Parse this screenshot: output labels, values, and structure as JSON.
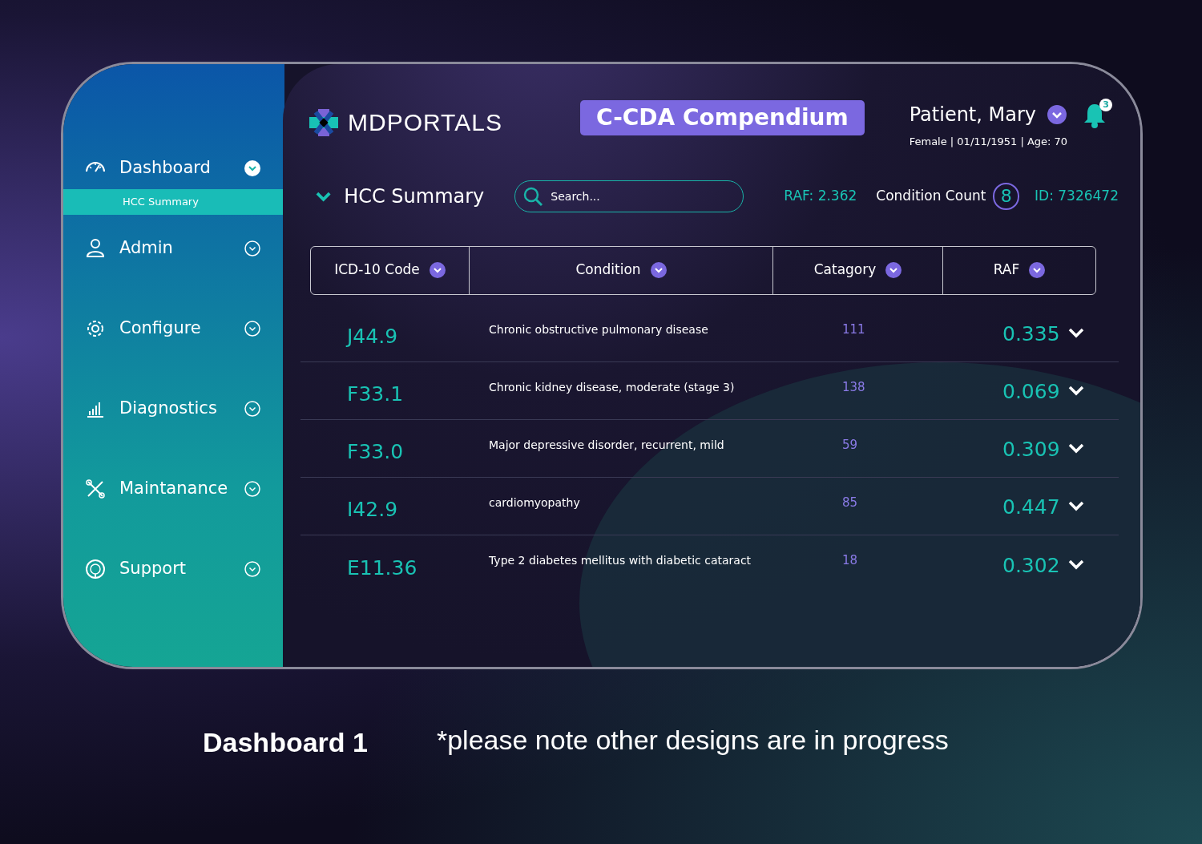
{
  "sidebar": {
    "items": [
      {
        "label": "Dashboard",
        "expanded": true,
        "children": [
          {
            "label": "HCC Summary",
            "selected": true
          }
        ]
      },
      {
        "label": "Admin",
        "expanded": false
      },
      {
        "label": "Configure",
        "expanded": false
      },
      {
        "label": "Diagnostics",
        "expanded": false
      },
      {
        "label": "Maintanance",
        "expanded": false
      },
      {
        "label": "Support",
        "expanded": false
      }
    ]
  },
  "header": {
    "logo_text": "MDPORTALS",
    "product_badge": "C-CDA Compendium",
    "patient_name": "Patient, Mary",
    "patient_details": "Female | 01/11/1951 | Age: 70",
    "notification_count": "3"
  },
  "summary": {
    "title": "HCC Summary",
    "search": {
      "placeholder": "Search..."
    },
    "raf": "RAF: 2.362",
    "condition_count_label": "Condition Count",
    "condition_count": "8",
    "patient_id": "ID: 7326472"
  },
  "table": {
    "columns": [
      "ICD-10 Code",
      "Condition",
      "Catagory",
      "RAF"
    ],
    "rows": [
      {
        "code": "J44.9",
        "condition": "Chronic obstructive pulmonary disease",
        "category": "111",
        "raf": "0.335"
      },
      {
        "code": "F33.1",
        "condition": "Chronic kidney disease, moderate (stage 3)",
        "category": "138",
        "raf": "0.069"
      },
      {
        "code": "F33.0",
        "condition": "Major depressive disorder, recurrent, mild",
        "category": "59",
        "raf": "0.309"
      },
      {
        "code": "I42.9",
        "condition": "cardiomyopathy",
        "category": "85",
        "raf": "0.447"
      },
      {
        "code": "E11.36",
        "condition": "Type 2 diabetes mellitus with diabetic cataract",
        "category": "18",
        "raf": "0.302"
      }
    ]
  },
  "caption": {
    "title": "Dashboard 1",
    "note": "*please note other designs are in progress"
  }
}
